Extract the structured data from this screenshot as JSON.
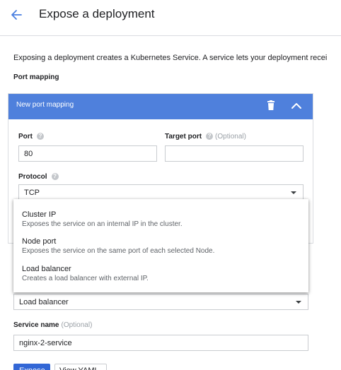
{
  "header": {
    "title": "Expose a deployment",
    "back_icon": "arrow-left-icon"
  },
  "intro": "Exposing a deployment creates a Kubernetes Service. A service lets your deployment recei",
  "port_mapping": {
    "section_label": "Port mapping",
    "card_title": "New port mapping",
    "port_label": "Port",
    "port_value": "80",
    "target_port_label": "Target port",
    "target_port_optional": "(Optional)",
    "target_port_value": "",
    "protocol_label": "Protocol",
    "protocol_value": "TCP"
  },
  "service_type_menu": {
    "items": [
      {
        "title": "Cluster IP",
        "description": "Exposes the service on an internal IP in the cluster."
      },
      {
        "title": "Node port",
        "description": "Exposes the service on the same port of each selected Node."
      },
      {
        "title": "Load balancer",
        "description": "Creates a load balancer with external IP."
      }
    ],
    "selected": "Load balancer"
  },
  "service_name": {
    "label": "Service name",
    "optional": "(Optional)",
    "value": "nginx-2-service"
  },
  "actions": {
    "expose_label": "Expose",
    "view_yaml_label": "View YAML"
  },
  "colors": {
    "card_header": "#4f80dc",
    "primary_button": "#3367d6",
    "back_arrow": "#1a73e8"
  }
}
